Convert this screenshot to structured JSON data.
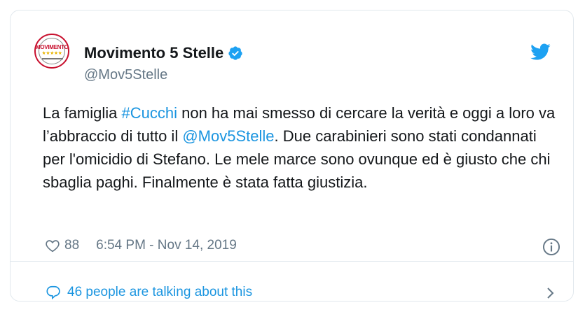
{
  "tweet": {
    "author_name": "Movimento 5 Stelle",
    "author_handle": "@Mov5Stelle",
    "avatar": {
      "logo_text": "MOVIMENTO",
      "logo_stars": "★★★★★"
    },
    "text_segments": [
      {
        "text": "La famiglia ",
        "link": false
      },
      {
        "text": "#Cucchi",
        "link": true
      },
      {
        "text": " non ha mai smesso di cercare la verità e oggi a loro va l’abbraccio di tutto il ",
        "link": false
      },
      {
        "text": "@Mov5Stelle",
        "link": true
      },
      {
        "text": ". Due carabinieri sono stati condannati per l'omicidio di Stefano. Le mele marce sono ovunque ed è giusto che chi sbaglia paghi. Finalmente è stata fatta giustizia.",
        "link": false
      }
    ],
    "likes": "88",
    "timestamp": "6:54 PM - Nov 14, 2019",
    "talking": "46 people are talking about this"
  },
  "icons": {
    "verified": "verified-badge-icon",
    "brand": "twitter-bird-icon",
    "like": "heart-icon",
    "info": "info-icon",
    "reply": "speech-bubble-icon",
    "more": "chevron-right-icon"
  },
  "colors": {
    "link": "#1b95e0",
    "secondary_text": "#657786",
    "primary_text": "#14171a",
    "border": "#e1e8ed"
  }
}
